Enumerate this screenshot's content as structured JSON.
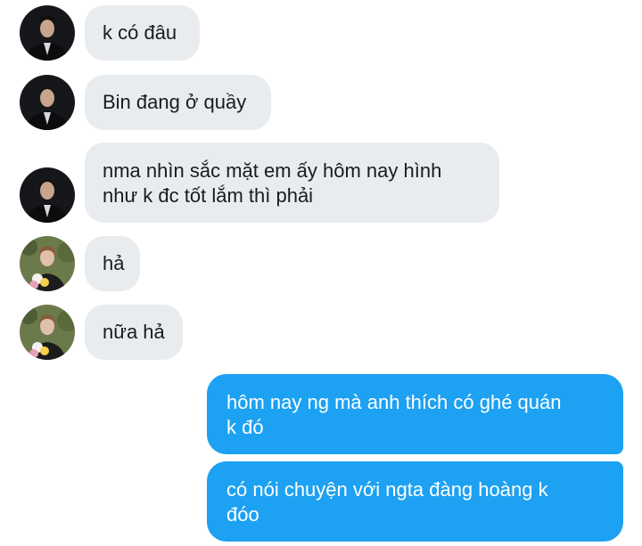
{
  "conversation": {
    "messages": [
      {
        "sender": "other",
        "avatar": "man-in-suit-avatar",
        "text": "k có đâu"
      },
      {
        "sender": "other",
        "avatar": "man-in-suit-avatar",
        "text": "Bin đang ở quầy"
      },
      {
        "sender": "other",
        "avatar": "man-in-suit-avatar",
        "text": "nma nhìn sắc mặt em ấy hôm nay hình\nnhư k đc tốt lắm thì phải"
      },
      {
        "sender": "other",
        "avatar": "person-with-flowers-avatar",
        "text": "hả"
      },
      {
        "sender": "other",
        "avatar": "person-with-flowers-avatar",
        "text": "nữa hả"
      },
      {
        "sender": "self",
        "text": "hôm nay ng mà anh thích có ghé quán\nk đó"
      },
      {
        "sender": "self",
        "text": "có nói chuyện với ngta đàng hoàng k\nđóo"
      }
    ]
  },
  "colors": {
    "incoming_bubble": "#e9ecef",
    "outgoing_bubble": "#1da1f2",
    "incoming_text": "#1b1b1b",
    "outgoing_text": "#ffffff"
  }
}
